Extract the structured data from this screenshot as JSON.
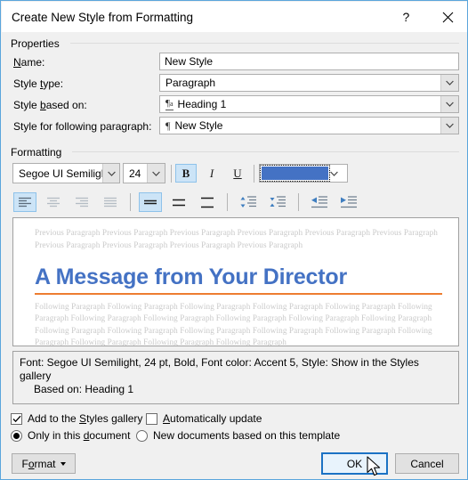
{
  "window": {
    "title": "Create New Style from Formatting",
    "help_label": "?",
    "close_label": "✕"
  },
  "properties": {
    "group_label": "Properties",
    "name_label": "Name:",
    "name_value": "New Style",
    "style_type_label": "Style type:",
    "style_type_value": "Paragraph",
    "style_based_on_label": "Style based on:",
    "style_based_on_value": "Heading 1",
    "style_following_label": "Style for following paragraph:",
    "style_following_value": "New Style"
  },
  "formatting": {
    "group_label": "Formatting",
    "font_name": "Segoe UI Semiligh",
    "font_size": "24",
    "bold_label": "B",
    "italic_label": "I",
    "underline_label": "U",
    "font_color": "#4472C4",
    "bold_active": true,
    "italic_active": false,
    "underline_active": false,
    "align_active": "left",
    "line_spacing_active": "single"
  },
  "preview": {
    "previous_paragraph": "Previous Paragraph Previous Paragraph Previous Paragraph Previous Paragraph Previous Paragraph Previous Paragraph Previous Paragraph Previous Paragraph Previous Paragraph Previous Paragraph",
    "heading": "A Message from Your Director",
    "following_paragraph": "Following Paragraph Following Paragraph Following Paragraph Following Paragraph Following Paragraph Following Paragraph Following Paragraph Following Paragraph Following Paragraph Following Paragraph Following Paragraph Following Paragraph Following Paragraph Following Paragraph Following Paragraph Following Paragraph Following Paragraph Following Paragraph Following Paragraph Following Paragraph",
    "heading_color": "#4472C4",
    "rule_color": "#ED7D31"
  },
  "description": {
    "line1": "Font: Segoe UI Semilight, 24 pt, Bold, Font color: Accent 5, Style: Show in the Styles gallery",
    "line2": "Based on: Heading 1"
  },
  "options": {
    "add_gallery_label_pre": "Add to the ",
    "add_gallery_label_acc": "S",
    "add_gallery_label_post": "tyles gallery",
    "add_gallery_checked": true,
    "auto_update_label_pre": "",
    "auto_update_label_acc": "A",
    "auto_update_label_post": "utomatically update",
    "auto_update_checked": false,
    "only_doc_label_pre": "Only in this ",
    "only_doc_label_acc": "d",
    "only_doc_label_post": "ocument",
    "only_doc_selected": true,
    "new_docs_label": "New documents based on this template",
    "new_docs_selected": false
  },
  "footer": {
    "format_label_pre": "F",
    "format_label_acc": "o",
    "format_label_post": "rmat",
    "ok_label": "OK",
    "cancel_label": "Cancel"
  },
  "icons": {
    "align_left": "align-left-icon",
    "align_center": "align-center-icon",
    "align_right": "align-right-icon",
    "align_justify": "align-justify-icon",
    "spacing_single": "line-spacing-single-icon",
    "spacing_onehalf": "line-spacing-1-5-icon",
    "spacing_double": "line-spacing-double-icon",
    "spacing_before": "spacing-before-icon",
    "spacing_after": "spacing-after-icon",
    "indent_decrease": "decrease-indent-icon",
    "indent_increase": "increase-indent-icon"
  }
}
